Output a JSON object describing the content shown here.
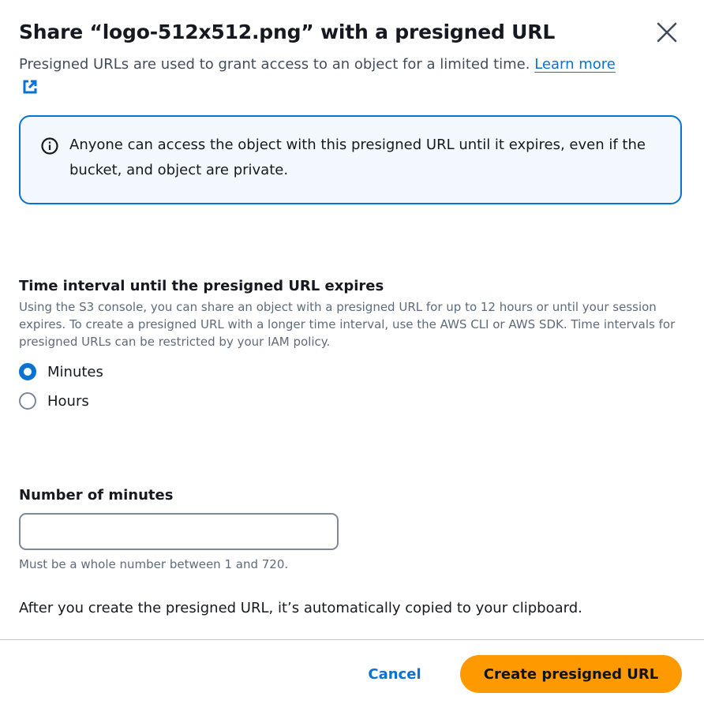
{
  "dialog": {
    "title": "Share “logo-512x512.png” with a presigned URL",
    "subtitle": "Presigned URLs are used to grant access to an object for a limited time.",
    "learn_more_label": "Learn more",
    "close_icon": "close-icon"
  },
  "alert": {
    "icon": "info-icon",
    "text": "Anyone can access the object with this presigned URL until it expires, even if the bucket, and object are private."
  },
  "expiration": {
    "label": "Time interval until the presigned URL expires",
    "description": "Using the S3 console, you can share an object with a presigned URL for up to 12 hours or until your session expires. To create a presigned URL with a longer time interval, use the AWS CLI or AWS SDK. Time intervals for presigned URLs can be restricted by your IAM policy.",
    "options": [
      {
        "label": "Minutes",
        "selected": true
      },
      {
        "label": "Hours",
        "selected": false
      }
    ]
  },
  "minutes_field": {
    "label": "Number of minutes",
    "value": "",
    "placeholder": "",
    "constraint": "Must be a whole number between 1 and 720."
  },
  "clipboard_note": "After you create the presigned URL, it’s automatically copied to your clipboard.",
  "footer": {
    "cancel_label": "Cancel",
    "create_label": "Create presigned URL"
  },
  "colors": {
    "accent": "#0972d3",
    "primary_button": "#ff9900",
    "alert_background": "#f2f8fd"
  }
}
